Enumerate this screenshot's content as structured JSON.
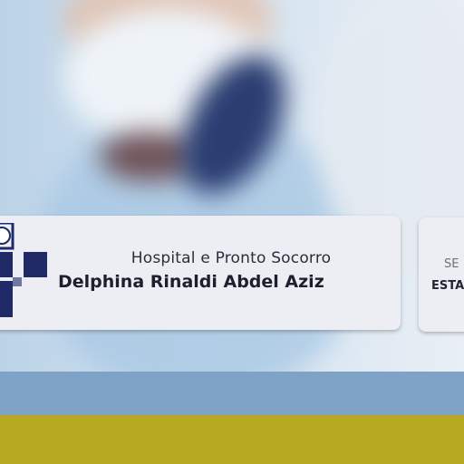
{
  "logo_card": {
    "subtitle": "Hospital e Pronto Socorro",
    "title": "Delphina Rinaldi Abdel Aziz",
    "logo_icon": "hospital-cross-logo-icon"
  },
  "side_card": {
    "line1": "SE",
    "line2": "ESTA"
  },
  "colors": {
    "logo_navy": "#1f2a66",
    "card_background": "#eceef4",
    "strip_blue": "#7ea3c7",
    "strip_yellow": "#b8a923"
  }
}
